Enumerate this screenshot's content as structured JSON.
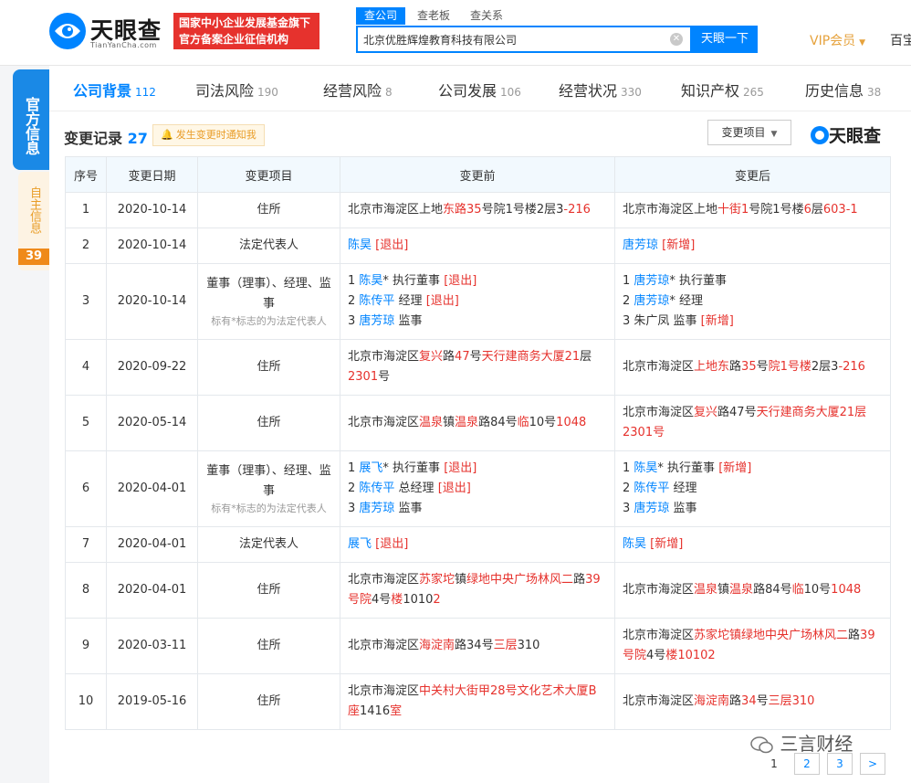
{
  "header": {
    "logo_name": "天眼查",
    "logo_url": "TianYanCha.com",
    "slogan_line1": "国家中小企业发展基金旗下",
    "slogan_line2": "官方备案企业征信机构",
    "search_tabs": [
      "查公司",
      "查老板",
      "查关系"
    ],
    "search_value": "北京优胜辉煌教育科技有限公司",
    "search_button": "天眼一下",
    "vip_label": "VIP会员",
    "more_link": "百宝"
  },
  "side": {
    "official_label": "官方信息",
    "self_label": "自主信息",
    "self_count": "39"
  },
  "nav": [
    {
      "label": "公司背景",
      "count": "112"
    },
    {
      "label": "司法风险",
      "count": "190"
    },
    {
      "label": "经营风险",
      "count": "8"
    },
    {
      "label": "公司发展",
      "count": "106"
    },
    {
      "label": "经营状况",
      "count": "330"
    },
    {
      "label": "知识产权",
      "count": "265"
    },
    {
      "label": "历史信息",
      "count": "38"
    }
  ],
  "section": {
    "title": "变更记录",
    "count": "27",
    "notify_label": "发生变更时通知我",
    "filter_label": "变更项目",
    "brand": "天眼查"
  },
  "table": {
    "headers": [
      "序号",
      "变更日期",
      "变更项目",
      "变更前",
      "变更后"
    ],
    "rows": [
      {
        "no": "1",
        "date": "2020-10-14",
        "item": "住所",
        "note": "",
        "before": [
          [
            [
              "北京市海淀区上地",
              ""
            ],
            [
              "东路35",
              "hl"
            ],
            [
              "号院1号楼2层3",
              ""
            ],
            [
              "-216",
              "hl"
            ]
          ]
        ],
        "after": [
          [
            [
              "北京市海淀区上地",
              ""
            ],
            [
              "十街1",
              "hl"
            ],
            [
              "号院1号楼",
              ""
            ],
            [
              "6",
              "hl"
            ],
            [
              "层",
              ""
            ],
            [
              "603-1",
              "hl"
            ]
          ]
        ]
      },
      {
        "no": "2",
        "date": "2020-10-14",
        "item": "法定代表人",
        "note": "",
        "before": [
          [
            [
              "陈昊",
              "bl"
            ],
            [
              " [退出]",
              "hl"
            ]
          ]
        ],
        "after": [
          [
            [
              "唐芳琼",
              "bl"
            ],
            [
              " [新增]",
              "hl"
            ]
          ]
        ]
      },
      {
        "no": "3",
        "date": "2020-10-14",
        "item": "董事（理事）、经理、监事",
        "note": "标有*标志的为法定代表人",
        "before": [
          [
            [
              "1 ",
              ""
            ],
            [
              "陈昊",
              "bl"
            ],
            [
              "* 执行董事 ",
              ""
            ],
            [
              "[退出]",
              "hl"
            ]
          ],
          [
            [
              "2 ",
              ""
            ],
            [
              "陈传平",
              "bl"
            ],
            [
              " 经理 ",
              ""
            ],
            [
              "[退出]",
              "hl"
            ]
          ],
          [
            [
              "3 ",
              ""
            ],
            [
              "唐芳琼",
              "bl"
            ],
            [
              " 监事",
              ""
            ]
          ]
        ],
        "after": [
          [
            [
              "1 ",
              ""
            ],
            [
              "唐芳琼",
              "bl"
            ],
            [
              "* 执行董事",
              ""
            ]
          ],
          [
            [
              "2 ",
              ""
            ],
            [
              "唐芳琼",
              "bl"
            ],
            [
              "* 经理",
              ""
            ]
          ],
          [
            [
              "3 朱广凤 监事 ",
              ""
            ],
            [
              "[新增]",
              "hl"
            ]
          ]
        ]
      },
      {
        "no": "4",
        "date": "2020-09-22",
        "item": "住所",
        "note": "",
        "before": [
          [
            [
              "北京市海淀区",
              ""
            ],
            [
              "复兴",
              "hl"
            ],
            [
              "路",
              ""
            ],
            [
              "47",
              "hl"
            ],
            [
              "号",
              ""
            ],
            [
              "天行建商务大厦21",
              "hl"
            ],
            [
              "层",
              ""
            ],
            [
              "2301",
              "hl"
            ],
            [
              "号",
              ""
            ]
          ]
        ],
        "after": [
          [
            [
              "北京市海淀区",
              ""
            ],
            [
              "上地东",
              "hl"
            ],
            [
              "路",
              ""
            ],
            [
              "35",
              "hl"
            ],
            [
              "号",
              ""
            ],
            [
              "院1号楼",
              "hl"
            ],
            [
              "2层3",
              ""
            ],
            [
              "-216",
              "hl"
            ]
          ]
        ]
      },
      {
        "no": "5",
        "date": "2020-05-14",
        "item": "住所",
        "note": "",
        "before": [
          [
            [
              "北京市海淀区",
              ""
            ],
            [
              "温泉",
              "hl"
            ],
            [
              "镇",
              ""
            ],
            [
              "温泉",
              "hl"
            ],
            [
              "路84号",
              ""
            ],
            [
              "临",
              "hl"
            ],
            [
              "10号",
              ""
            ],
            [
              "1048",
              "hl"
            ]
          ]
        ],
        "after": [
          [
            [
              "北京市海淀区",
              ""
            ],
            [
              "复兴",
              "hl"
            ],
            [
              "路47号",
              ""
            ],
            [
              "天行建商务大厦",
              "hl"
            ],
            [
              "21层",
              "hl"
            ],
            [
              "2301号",
              "hl"
            ]
          ]
        ]
      },
      {
        "no": "6",
        "date": "2020-04-01",
        "item": "董事（理事）、经理、监事",
        "note": "标有*标志的为法定代表人",
        "before": [
          [
            [
              "1 ",
              ""
            ],
            [
              "展飞",
              "bl"
            ],
            [
              "* 执行董事 ",
              ""
            ],
            [
              "[退出]",
              "hl"
            ]
          ],
          [
            [
              "2 ",
              ""
            ],
            [
              "陈传平",
              "bl"
            ],
            [
              " 总经理 ",
              ""
            ],
            [
              "[退出]",
              "hl"
            ]
          ],
          [
            [
              "3 ",
              ""
            ],
            [
              "唐芳琼",
              "bl"
            ],
            [
              " 监事",
              ""
            ]
          ]
        ],
        "after": [
          [
            [
              "1 ",
              ""
            ],
            [
              "陈昊",
              "bl"
            ],
            [
              "* 执行董事 ",
              ""
            ],
            [
              "[新增]",
              "hl"
            ]
          ],
          [
            [
              "2 ",
              ""
            ],
            [
              "陈传平",
              "bl"
            ],
            [
              " 经理",
              ""
            ]
          ],
          [
            [
              "3 ",
              ""
            ],
            [
              "唐芳琼",
              "bl"
            ],
            [
              " 监事",
              ""
            ]
          ]
        ]
      },
      {
        "no": "7",
        "date": "2020-04-01",
        "item": "法定代表人",
        "note": "",
        "before": [
          [
            [
              "展飞",
              "bl"
            ],
            [
              " [退出]",
              "hl"
            ]
          ]
        ],
        "after": [
          [
            [
              "陈昊",
              "bl"
            ],
            [
              " [新增]",
              "hl"
            ]
          ]
        ]
      },
      {
        "no": "8",
        "date": "2020-04-01",
        "item": "住所",
        "note": "",
        "before": [
          [
            [
              "北京市海淀区",
              ""
            ],
            [
              "苏家坨",
              "hl"
            ],
            [
              "镇",
              ""
            ],
            [
              "绿地中央广场林风二",
              "hl"
            ],
            [
              "路",
              ""
            ],
            [
              "39号院",
              "hl"
            ],
            [
              "4号",
              ""
            ],
            [
              "楼",
              "hl"
            ],
            [
              "1010",
              ""
            ],
            [
              "2",
              "hl"
            ]
          ]
        ],
        "after": [
          [
            [
              "北京市海淀区",
              ""
            ],
            [
              "温泉",
              "hl"
            ],
            [
              "镇",
              ""
            ],
            [
              "温泉",
              "hl"
            ],
            [
              "路84号",
              ""
            ],
            [
              "临",
              "hl"
            ],
            [
              "10号",
              ""
            ],
            [
              "1048",
              "hl"
            ]
          ]
        ]
      },
      {
        "no": "9",
        "date": "2020-03-11",
        "item": "住所",
        "note": "",
        "before": [
          [
            [
              "北京市海淀区",
              ""
            ],
            [
              "海淀南",
              "hl"
            ],
            [
              "路34号",
              ""
            ],
            [
              "三层",
              "hl"
            ],
            [
              "310",
              ""
            ]
          ]
        ],
        "after": [
          [
            [
              "北京市海淀区",
              ""
            ],
            [
              "苏家坨镇绿地中央广场林风二",
              "hl"
            ],
            [
              "路",
              ""
            ],
            [
              "39号院",
              "hl"
            ],
            [
              "4号",
              ""
            ],
            [
              "楼",
              "hl"
            ],
            [
              "10102",
              "hl"
            ]
          ]
        ]
      },
      {
        "no": "10",
        "date": "2019-05-16",
        "item": "住所",
        "note": "",
        "before": [
          [
            [
              "北京市海淀区",
              ""
            ],
            [
              "中关村大街甲28号文化艺术大厦",
              "hl"
            ],
            [
              "B座",
              "hl"
            ],
            [
              "1416",
              ""
            ],
            [
              "室",
              "hl"
            ]
          ]
        ],
        "after": [
          [
            [
              "北京市海淀区",
              ""
            ],
            [
              "海淀南",
              "hl"
            ],
            [
              "路",
              ""
            ],
            [
              "34",
              "hl"
            ],
            [
              "号",
              ""
            ],
            [
              "三层",
              "hl"
            ],
            [
              "310",
              "hl"
            ]
          ]
        ]
      }
    ]
  },
  "pager": {
    "pages": [
      "1",
      "2",
      "3"
    ],
    "next": ">"
  },
  "watermark": "三言财经"
}
